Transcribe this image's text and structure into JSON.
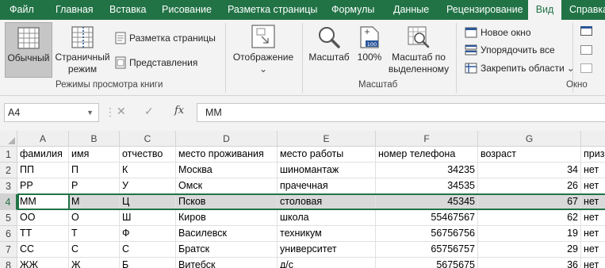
{
  "tabs": [
    "Файл",
    "Главная",
    "Вставка",
    "Рисование",
    "Разметка страницы",
    "Формулы",
    "Данные",
    "Рецензирование",
    "Вид",
    "Справка"
  ],
  "active_tab": "Вид",
  "ribbon": {
    "views_group": {
      "normal": "Обычный",
      "page_break": [
        "Страничный",
        "режим"
      ],
      "page_layout": "Разметка страницы",
      "custom_views": "Представления",
      "label": "Режимы просмотра книги"
    },
    "show_group": {
      "show": "Отображение",
      "chevron": "⌄"
    },
    "zoom_group": {
      "zoom": "Масштаб",
      "zoom100": "100%",
      "zoom_sel": [
        "Масштаб по",
        "выделенному"
      ],
      "label": "Масштаб"
    },
    "window_group": {
      "new_window": "Новое окно",
      "arrange_all": "Упорядочить все",
      "freeze": "Закрепить области",
      "freeze_chevron": "⌄",
      "label": "Окно"
    }
  },
  "formula_bar": {
    "name_box": "A4",
    "cancel": "✕",
    "enter": "✓",
    "fx": "fx",
    "value": "ММ"
  },
  "columns": [
    "A",
    "B",
    "C",
    "D",
    "E",
    "F",
    "G"
  ],
  "rows": [
    {
      "num": "1",
      "cells": [
        "фамилия",
        "имя",
        "отчество",
        "место проживания",
        "место работы",
        "номер телефона",
        "возраст",
        "приз"
      ]
    },
    {
      "num": "2",
      "cells": [
        "ПП",
        "П",
        "К",
        "Москва",
        "шиномантаж",
        "34235",
        "34",
        "нет"
      ]
    },
    {
      "num": "3",
      "cells": [
        "РР",
        "Р",
        "У",
        "Омск",
        "прачечная",
        "34535",
        "26",
        "нет"
      ]
    },
    {
      "num": "4",
      "cells": [
        "ММ",
        "М",
        "Ц",
        "Псков",
        "столовая",
        "45345",
        "67",
        "нет"
      ]
    },
    {
      "num": "5",
      "cells": [
        "ОО",
        "О",
        "Ш",
        "Киров",
        "школа",
        "55467567",
        "62",
        "нет"
      ]
    },
    {
      "num": "6",
      "cells": [
        "ТТ",
        "Т",
        "Ф",
        "Василевск",
        "техникум",
        "56756756",
        "19",
        "нет"
      ]
    },
    {
      "num": "7",
      "cells": [
        "СС",
        "С",
        "С",
        "Братск",
        "университет",
        "65756757",
        "29",
        "нет"
      ]
    },
    {
      "num": "8",
      "cells": [
        "ЖЖ",
        "Ж",
        "Б",
        "Витебск",
        "д/с",
        "5675675",
        "36",
        "нет"
      ]
    }
  ],
  "colors": {
    "accent": "#217346",
    "ribbon_bg": "#f3f3f3",
    "selection": "#d9d9d9"
  }
}
